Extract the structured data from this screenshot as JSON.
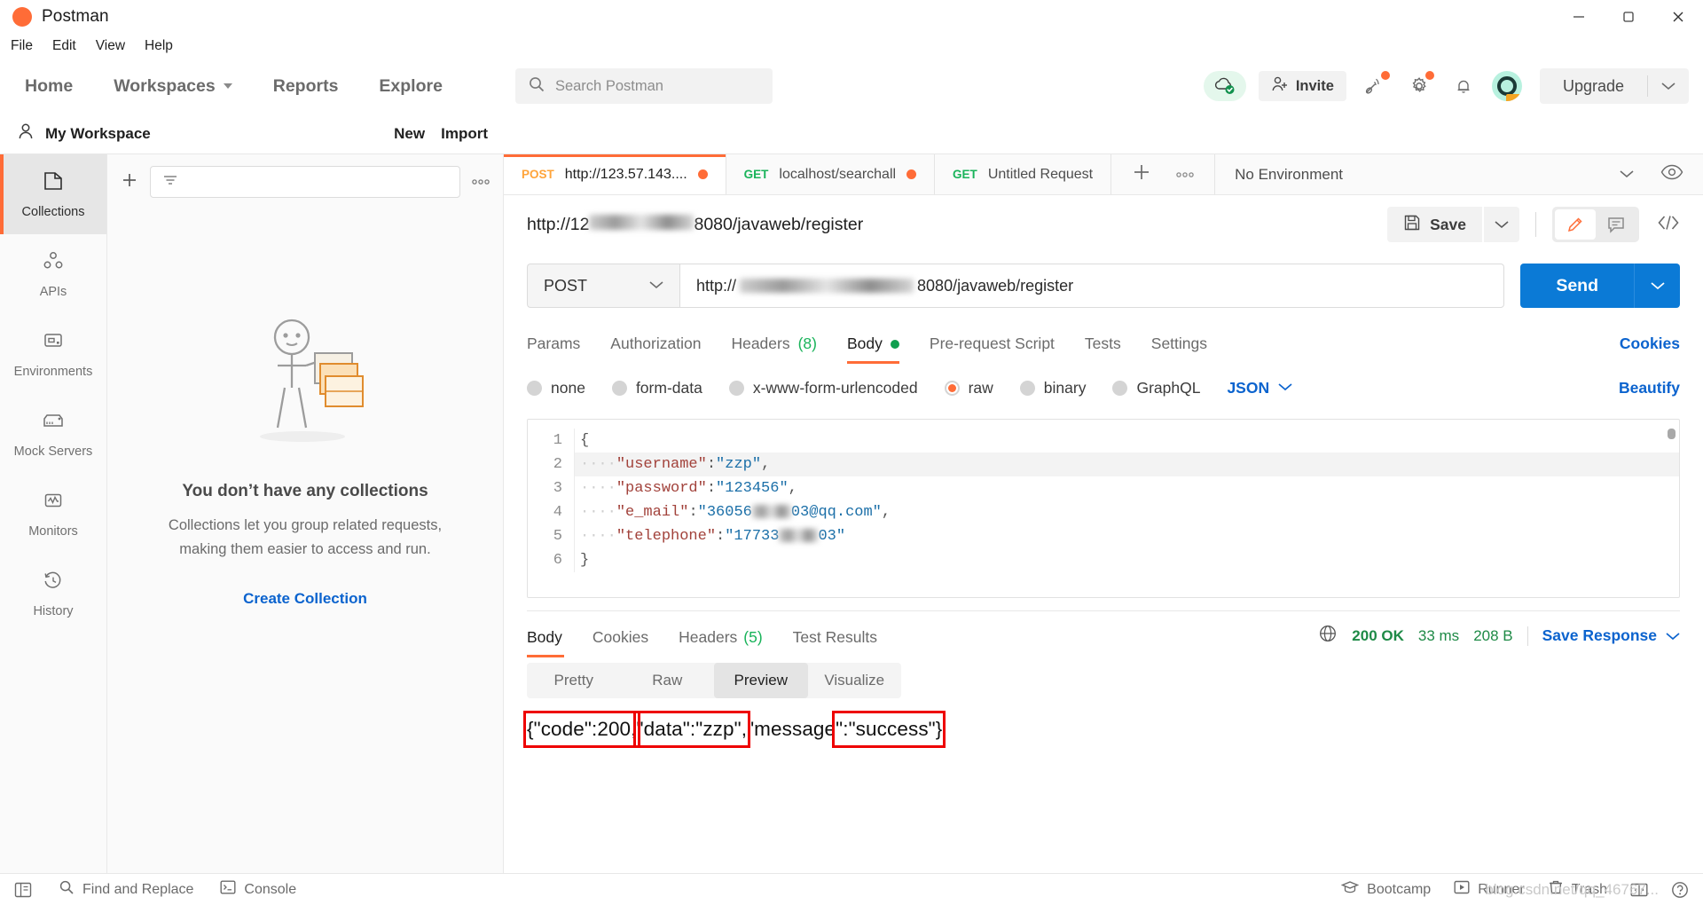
{
  "window": {
    "app_title": "Postman",
    "logo_icon": "postman-logo-icon",
    "minimize_icon": "minimize-icon",
    "maximize_icon": "maximize-icon",
    "close_icon": "close-icon"
  },
  "menubar": {
    "items": [
      "File",
      "Edit",
      "View",
      "Help"
    ]
  },
  "topnav": {
    "links": [
      "Home",
      "Workspaces",
      "Reports",
      "Explore"
    ],
    "search": {
      "placeholder": "Search Postman",
      "icon": "search-icon"
    },
    "cloud_icon": "cloud-sync-check-icon",
    "invite": {
      "label": "Invite",
      "icon": "user-plus-icon"
    },
    "satellite_icon": "satellite-icon",
    "gear_icon": "gear-icon",
    "bell_icon": "bell-icon",
    "avatar_icon": "user-avatar",
    "upgrade": {
      "label": "Upgrade",
      "caret_icon": "chevron-down-icon"
    }
  },
  "workspace_row": {
    "icon": "person-icon",
    "name": "My Workspace",
    "new_label": "New",
    "import_label": "Import"
  },
  "sidebar": {
    "items": [
      {
        "label": "Collections",
        "icon": "collections-icon",
        "active": true
      },
      {
        "label": "APIs",
        "icon": "apis-icon",
        "active": false
      },
      {
        "label": "Environments",
        "icon": "environments-icon",
        "active": false
      },
      {
        "label": "Mock Servers",
        "icon": "mock-servers-icon",
        "active": false
      },
      {
        "label": "Monitors",
        "icon": "monitors-icon",
        "active": false
      },
      {
        "label": "History",
        "icon": "history-icon",
        "active": false
      }
    ]
  },
  "collections_panel": {
    "add_icon": "plus-icon",
    "filter_icon": "filter-icon",
    "filter_value": "",
    "more_icon": "more-horizontal-icon",
    "empty_heading": "You don’t have any collections",
    "empty_body": "Collections let you group related requests, making them easier to access and run.",
    "empty_action": "Create Collection",
    "illustration": "empty-collections-illustration"
  },
  "request_tabs": {
    "tabs": [
      {
        "method": "POST",
        "name": "http://123.57.143....",
        "unsaved": true,
        "active": true
      },
      {
        "method": "GET",
        "name": "localhost/searchall",
        "unsaved": true,
        "active": false
      },
      {
        "method": "GET",
        "name": "Untitled Request",
        "unsaved": false,
        "active": false
      }
    ],
    "new_tab_icon": "plus-icon",
    "tab_more_icon": "more-horizontal-icon",
    "environment": {
      "label": "No Environment",
      "caret_icon": "chevron-down-icon",
      "eye_icon": "eye-icon"
    }
  },
  "request_header": {
    "title_prefix": "http://12",
    "title_suffix": "8080/javaweb/register",
    "save": {
      "label": "Save",
      "icon": "save-disk-icon",
      "caret_icon": "chevron-down-icon"
    },
    "edit_icon": "pencil-icon",
    "comment_icon": "comment-icon",
    "code_icon": "code-brackets-icon"
  },
  "url_bar": {
    "method": "POST",
    "method_caret_icon": "chevron-down-icon",
    "url_prefix": "http://",
    "url_suffix": "8080/javaweb/register",
    "send_label": "Send",
    "send_caret_icon": "chevron-down-icon"
  },
  "request_section_tabs": {
    "tabs": [
      {
        "label": "Params",
        "selected": false
      },
      {
        "label": "Authorization",
        "selected": false
      },
      {
        "label": "Headers",
        "count": "(8)",
        "selected": false
      },
      {
        "label": "Body",
        "dot": true,
        "selected": true
      },
      {
        "label": "Pre-request Script",
        "selected": false
      },
      {
        "label": "Tests",
        "selected": false
      },
      {
        "label": "Settings",
        "selected": false
      }
    ],
    "cookies_link": "Cookies"
  },
  "body_options": {
    "radios": [
      {
        "label": "none",
        "selected": false
      },
      {
        "label": "form-data",
        "selected": false
      },
      {
        "label": "x-www-form-urlencoded",
        "selected": false
      },
      {
        "label": "raw",
        "selected": true
      },
      {
        "label": "binary",
        "selected": false
      },
      {
        "label": "GraphQL",
        "selected": false
      }
    ],
    "format": "JSON",
    "format_caret_icon": "chevron-down-icon",
    "beautify": "Beautify"
  },
  "editor": {
    "line_numbers": [
      "1",
      "2",
      "3",
      "4",
      "5",
      "6"
    ],
    "lines": [
      {
        "n": 1,
        "segments": [
          {
            "t": "{",
            "c": "p"
          }
        ],
        "highlight": false
      },
      {
        "n": 2,
        "segments": [
          {
            "t": "····",
            "c": "ind"
          },
          {
            "t": "\"username\"",
            "c": "k"
          },
          {
            "t": ":",
            "c": "p"
          },
          {
            "t": "\"zzp\"",
            "c": "v"
          },
          {
            "t": ",",
            "c": "p"
          }
        ],
        "highlight": true
      },
      {
        "n": 3,
        "segments": [
          {
            "t": "····",
            "c": "ind"
          },
          {
            "t": "\"password\"",
            "c": "k"
          },
          {
            "t": ":",
            "c": "p"
          },
          {
            "t": "\"123456\"",
            "c": "v"
          },
          {
            "t": ",",
            "c": "p"
          }
        ],
        "highlight": false
      },
      {
        "n": 4,
        "segments": [
          {
            "t": "····",
            "c": "ind"
          },
          {
            "t": "\"e_mail\"",
            "c": "k"
          },
          {
            "t": ":",
            "c": "p"
          },
          {
            "t": "\"36056",
            "c": "v"
          },
          {
            "t": "BLUR",
            "c": "blur"
          },
          {
            "t": "03@qq.com\"",
            "c": "v"
          },
          {
            "t": ",",
            "c": "p"
          }
        ],
        "highlight": false
      },
      {
        "n": 5,
        "segments": [
          {
            "t": "····",
            "c": "ind"
          },
          {
            "t": "\"telephone\"",
            "c": "k"
          },
          {
            "t": ":",
            "c": "p"
          },
          {
            "t": "\"17733",
            "c": "v"
          },
          {
            "t": "BLUR",
            "c": "blur"
          },
          {
            "t": "03\"",
            "c": "v"
          }
        ],
        "highlight": false
      },
      {
        "n": 6,
        "segments": [
          {
            "t": "}",
            "c": "p"
          }
        ],
        "highlight": false
      }
    ]
  },
  "response": {
    "tabs": [
      {
        "label": "Body",
        "selected": true
      },
      {
        "label": "Cookies",
        "selected": false
      },
      {
        "label": "Headers",
        "count": "(5)",
        "selected": false
      },
      {
        "label": "Test Results",
        "selected": false
      }
    ],
    "globe_icon": "globe-icon",
    "status": "200 OK",
    "time": "33 ms",
    "size": "208 B",
    "save_response": "Save Response",
    "save_response_caret_icon": "chevron-down-icon",
    "view_tabs": [
      {
        "label": "Pretty",
        "selected": false
      },
      {
        "label": "Raw",
        "selected": false
      },
      {
        "label": "Preview",
        "selected": true
      },
      {
        "label": "Visualize",
        "selected": false
      }
    ],
    "preview_body": "{\"code\":200,\"data\":\"zzp\",\"message\":\"success\"}",
    "annotation_color": "#ee0000",
    "annotations": [
      {
        "label": "annotation-box-code"
      },
      {
        "label": "annotation-box-data"
      },
      {
        "label": "annotation-box-message"
      }
    ]
  },
  "statusbar": {
    "sidebar_toggle_icon": "sidebar-toggle-icon",
    "find_replace": {
      "label": "Find and Replace",
      "icon": "search-icon"
    },
    "console": {
      "label": "Console",
      "icon": "terminal-icon"
    },
    "bootcamp": {
      "label": "Bootcamp",
      "icon": "graduation-cap-icon"
    },
    "runner": {
      "label": "Runner",
      "icon": "play-box-icon"
    },
    "trash": {
      "label": "Trash",
      "icon": "trash-icon"
    },
    "two_pane_icon": "two-pane-icon",
    "help_icon": "help-circle-icon",
    "watermark": "blog.csdn.net/qq_46767..."
  },
  "colors": {
    "accent": "#ff6c37",
    "link": "#0b63ce",
    "send": "#0b7ad6",
    "success": "#1e8a46",
    "annotation": "#ee0000"
  }
}
